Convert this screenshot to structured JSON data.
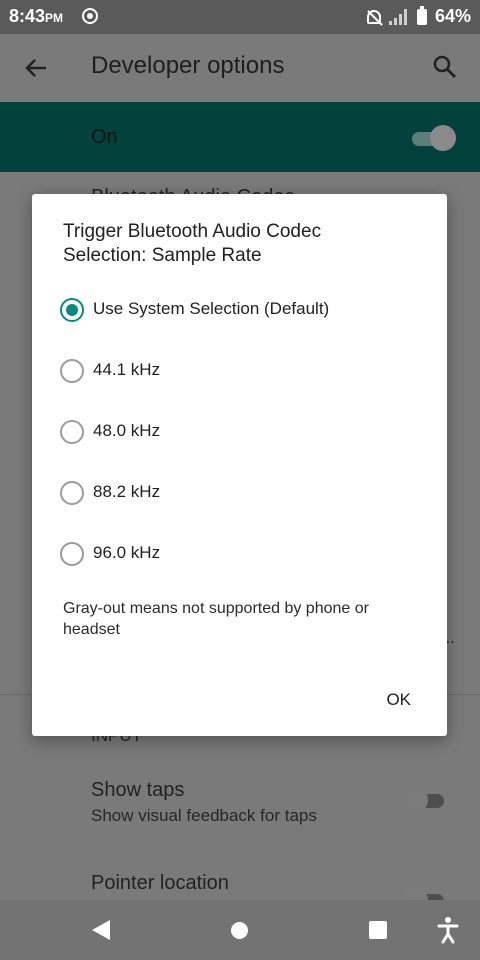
{
  "status_bar": {
    "time": "8:43",
    "ampm": "PM",
    "battery": "64%"
  },
  "app_bar": {
    "title": "Developer options"
  },
  "master_switch": {
    "label": "On",
    "state": true
  },
  "background": {
    "partial_item": "Bluetooth Audio Codec",
    "partial_right": "e..",
    "partial_bottom": "INPUT",
    "show_taps": {
      "title": "Show taps",
      "subtitle": "Show visual feedback for taps",
      "state": false
    },
    "pointer_location": {
      "title": "Pointer location",
      "state": false
    }
  },
  "dialog": {
    "title": "Trigger Bluetooth Audio Codec Selection: Sample Rate",
    "options": [
      {
        "label": "Use System Selection (Default)",
        "selected": true
      },
      {
        "label": "44.1 kHz",
        "selected": false
      },
      {
        "label": "48.0 kHz",
        "selected": false
      },
      {
        "label": "88.2 kHz",
        "selected": false
      },
      {
        "label": "96.0 kHz",
        "selected": false
      }
    ],
    "note": "Gray-out means not supported by phone or headset",
    "ok_label": "OK"
  },
  "colors": {
    "accent": "#08897b",
    "on_bar": "#03423c"
  }
}
